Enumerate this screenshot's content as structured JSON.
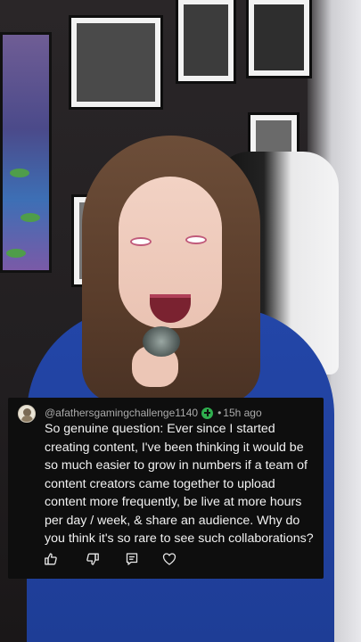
{
  "comment": {
    "author": "@afathersgamingchallenge1140",
    "separator": "•",
    "time": "15h ago",
    "text": "So genuine question: Ever since I started creating content, I've been thinking it would be so much easier to grow in numbers if a team of content creators came together to upload content more frequently, be live at more hours per day / week, & share an audience. Why do you think it's so rare to see such collaborations?",
    "verified_color": "#2fae4e"
  },
  "actions": [
    {
      "icon": "thumbs-up-icon"
    },
    {
      "icon": "thumbs-down-icon"
    },
    {
      "icon": "reply-icon"
    },
    {
      "icon": "heart-icon"
    }
  ]
}
